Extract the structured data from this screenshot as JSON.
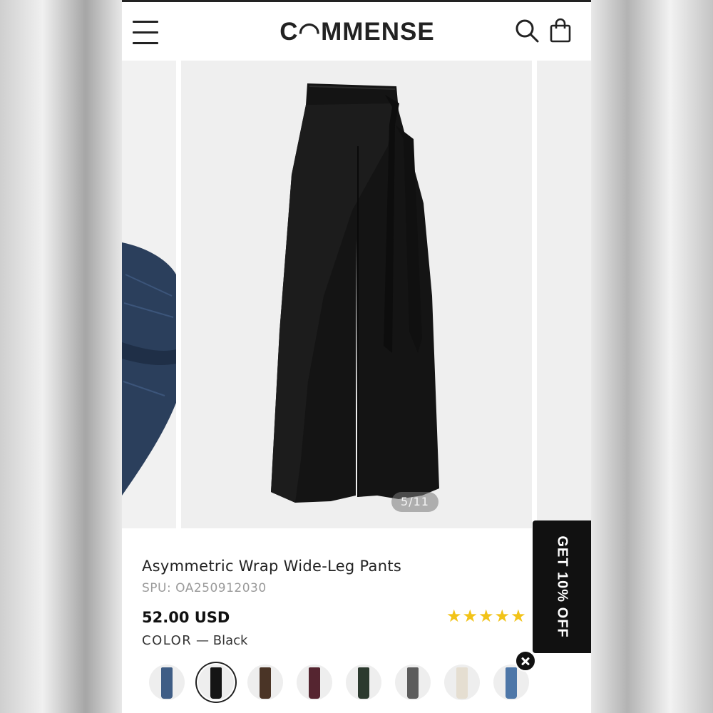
{
  "header": {
    "logo_text": "C◠MMENSE",
    "menu_icon": "hamburger-menu-icon",
    "search_icon": "search-icon",
    "bag_icon": "shopping-bag-icon"
  },
  "gallery": {
    "counter": "5/11"
  },
  "promo": {
    "label": "GET 10% OFF",
    "close_icon": "close-icon"
  },
  "product": {
    "title": "Asymmetric Wrap Wide-Leg Pants",
    "spu": "SPU: OA250912030",
    "price": "52.00 USD",
    "rating_stars": "★★★★★",
    "color_label": "COLOR",
    "color_sep": " — ",
    "color_value": "Black"
  },
  "swatches": [
    {
      "color": "#3f5d85",
      "selected": false
    },
    {
      "color": "#151515",
      "selected": true
    },
    {
      "color": "#4a3426",
      "selected": false
    },
    {
      "color": "#552530",
      "selected": false
    },
    {
      "color": "#2c3a2f",
      "selected": false
    },
    {
      "color": "#5c5c5c",
      "selected": false
    },
    {
      "color": "#e5ded1",
      "selected": false
    },
    {
      "color": "#4e77a8",
      "selected": false
    }
  ]
}
